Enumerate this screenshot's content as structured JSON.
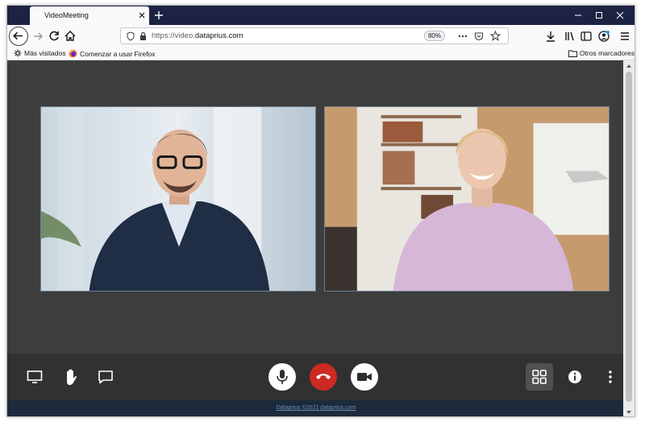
{
  "browser": {
    "tab_title": "VideoMeeting",
    "url_prefix": "https://video.",
    "url_domain": "dataprius.com",
    "zoom": "80%",
    "bookmarks": [
      {
        "label": "Más visitados",
        "icon": "gear-icon"
      },
      {
        "label": "Comenzar a usar Firefox",
        "icon": "firefox-icon"
      }
    ],
    "other_bookmarks": "Otros marcadores"
  },
  "meeting": {
    "participants": [
      {
        "tile": "participant-video-1"
      },
      {
        "tile": "participant-video-2"
      }
    ],
    "controls_left": [
      "screen-share-icon",
      "raise-hand-icon",
      "chat-icon"
    ],
    "controls_center": [
      "microphone-icon",
      "hang-up-icon",
      "camera-icon"
    ],
    "controls_right": [
      "grid-view-icon",
      "info-icon",
      "more-options-icon"
    ],
    "colors": {
      "hangup": "#cc2a22",
      "background": "#3d3d3d",
      "toolbar": "#313131",
      "footer": "#1c2a3c"
    }
  },
  "footer": {
    "link": "Dataprius ©2021 dataprius.com"
  }
}
